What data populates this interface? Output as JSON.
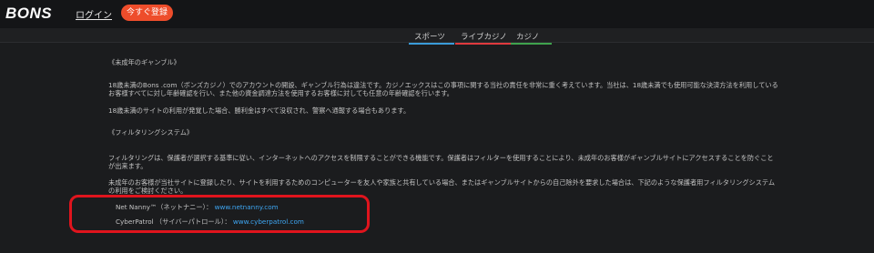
{
  "header": {
    "logo": "BONS",
    "login_label": "ログイン",
    "register_label": "今すぐ登録"
  },
  "nav": {
    "tabs": [
      {
        "label": "スポーツ",
        "color": "#3a9bd9"
      },
      {
        "label": "ライブカジノ",
        "color": "#e03a3e"
      },
      {
        "label": "カジノ",
        "color": "#3fa34d"
      }
    ]
  },
  "content": {
    "section1_title": "《未成年のギャンブル》",
    "p1_line1": "18歳未満のBons .com（ボンズカジノ）でのアカウントの開設、ギャンブル行為は違法です。カジノエックスはこの事項に関する当社の責任を非常に重く考えています。当社は、18歳未満でも使用可能な決済方法を利用している",
    "p1_line2": "お客様すべてに対し年齢確認を行い、また他の資金調達方法を使用するお客様に対しても任意の年齢確認を行います。",
    "p2": "18歳未満のサイトの利用が発覚した場合、勝利金はすべて没収され、警察へ通報する場合もあります。",
    "section2_title": "《フィルタリングシステム》",
    "p3_line1": "フィルタリングは、保護者が選択する基準に従い、インターネットへのアクセスを制限することができる機能です。保護者はフィルターを使用することにより、未成年のお客様がギャンブルサイトにアクセスすることを防ぐこと",
    "p3_line2": "が出来ます。",
    "p4_line1": "未成年のお客様が当社サイトに登録したり、サイトを利用するためのコンピューターを友人や家族と共有している場合、またはギャンブルサイトからの自己除外を要求した場合は、下記のような保護者用フィルタリングシステム",
    "p4_line2": "の利用をご検討ください。",
    "filters": [
      {
        "name": "Net Nanny™（ネットナニー）：",
        "url": "www.netnanny.com"
      },
      {
        "name": "CyberPatrol （サイバーパトロール）：",
        "url": "www.cyberpatrol.com"
      }
    ]
  },
  "colors": {
    "highlight": "#e0141d",
    "register": "#ee4d2b",
    "link": "#3ea6f2"
  }
}
